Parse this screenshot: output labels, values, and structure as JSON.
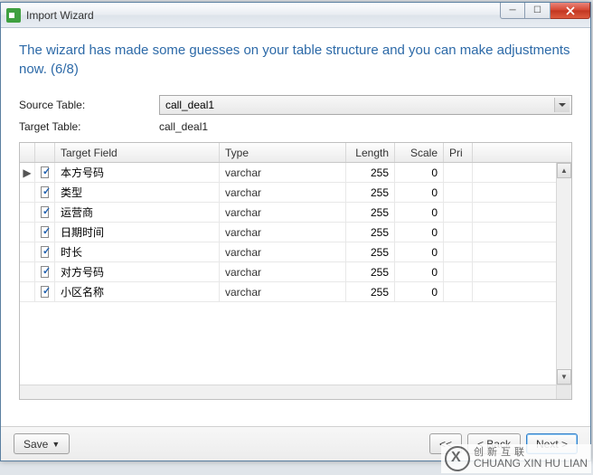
{
  "window": {
    "title": "Import Wizard"
  },
  "heading": "The wizard has made some guesses on your table structure and you can make adjustments now. (6/8)",
  "form": {
    "source_label": "Source Table:",
    "source_value": "call_deal1",
    "target_label": "Target Table:",
    "target_value": "call_deal1"
  },
  "grid": {
    "headers": {
      "field": "Target Field",
      "type": "Type",
      "length": "Length",
      "scale": "Scale",
      "pri": "Pri"
    },
    "rows": [
      {
        "indicator": "▶",
        "checked": true,
        "field": "本方号码",
        "type": "varchar",
        "length": "255",
        "scale": "0"
      },
      {
        "indicator": "",
        "checked": true,
        "field": "类型",
        "type": "varchar",
        "length": "255",
        "scale": "0"
      },
      {
        "indicator": "",
        "checked": true,
        "field": "运营商",
        "type": "varchar",
        "length": "255",
        "scale": "0"
      },
      {
        "indicator": "",
        "checked": true,
        "field": "日期时间",
        "type": "varchar",
        "length": "255",
        "scale": "0"
      },
      {
        "indicator": "",
        "checked": true,
        "field": "时长",
        "type": "varchar",
        "length": "255",
        "scale": "0"
      },
      {
        "indicator": "",
        "checked": true,
        "field": "对方号码",
        "type": "varchar",
        "length": "255",
        "scale": "0"
      },
      {
        "indicator": "",
        "checked": true,
        "field": "小区名称",
        "type": "varchar",
        "length": "255",
        "scale": "0"
      }
    ]
  },
  "footer": {
    "save": "Save",
    "first": "<<",
    "back": "< Back",
    "next": "Next >",
    "last_hidden": ">>"
  },
  "watermark": {
    "cn": "创新互联",
    "en": "CHUANG XIN HU LIAN"
  },
  "bg_watermark": "http://blog.csdn.net/"
}
